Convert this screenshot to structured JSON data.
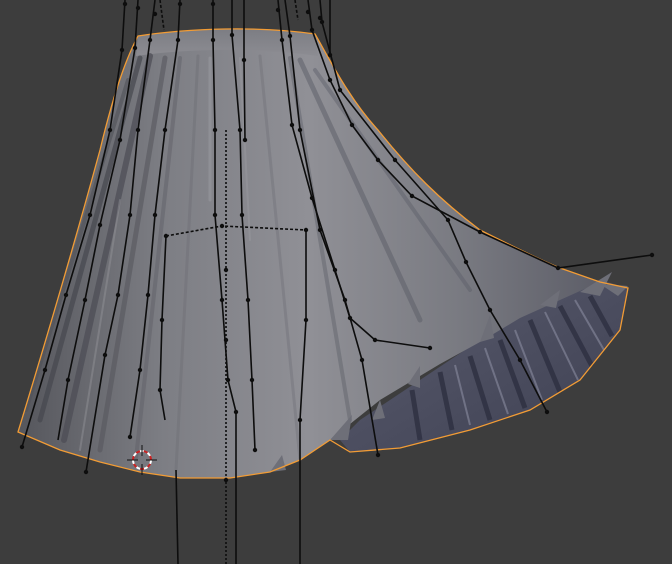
{
  "viewport": {
    "background_color": "#3d3d3d",
    "selection_outline_color": "#f29c35",
    "mesh_color": "#8a8a92",
    "bone_color": "#0d0d0d",
    "cursor_colors": [
      "#cc2222",
      "#ffffff"
    ]
  },
  "scene": {
    "selected_object": "skirt-mesh",
    "rig": "skirt-bone-chains",
    "cursor_icon": "3d-cursor-icon"
  }
}
